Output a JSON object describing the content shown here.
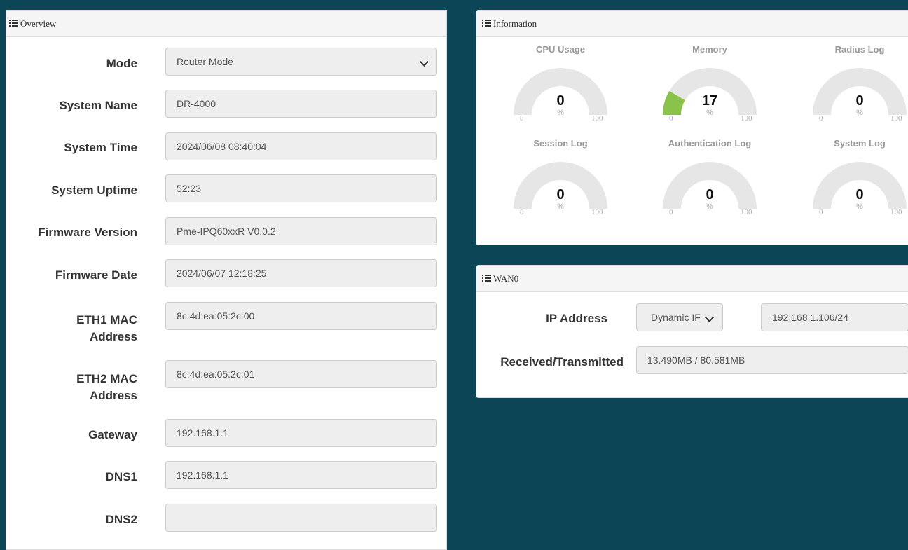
{
  "overview": {
    "title": "Overview",
    "fields": [
      {
        "label": "Mode",
        "value": "Router Mode"
      },
      {
        "label": "System Name",
        "value": "DR-4000"
      },
      {
        "label": "System Time",
        "value": "2024/06/08 08:40:04"
      },
      {
        "label": "System Uptime",
        "value": "52:23"
      },
      {
        "label": "Firmware Version",
        "value": "Pme-IPQ60xxR V0.0.2"
      },
      {
        "label": "Firmware Date",
        "value": "2024/06/07 12:18:25"
      },
      {
        "label_line1": "ETH1 MAC",
        "label_line2": "Address",
        "value": "8c:4d:ea:05:2c:00"
      },
      {
        "label_line1": "ETH2 MAC",
        "label_line2": "Address",
        "value": "8c:4d:ea:05:2c:01"
      },
      {
        "label": "Gateway",
        "value": "192.168.1.1"
      },
      {
        "label": "DNS1",
        "value": "192.168.1.1"
      },
      {
        "label": "DNS2",
        "value": ""
      }
    ]
  },
  "information": {
    "title": "Information",
    "gauge_color": "#8bc34a",
    "track_color": "#e6e6e6",
    "gauges": [
      {
        "title": "CPU Usage",
        "value": 0,
        "unit": "%",
        "min": "0",
        "max": "100"
      },
      {
        "title": "Memory",
        "value": 17,
        "unit": "%",
        "min": "0",
        "max": "100"
      },
      {
        "title": "Radius Log",
        "value": 0,
        "unit": "%",
        "min": "0",
        "max": "100"
      },
      {
        "title": "Session Log",
        "value": 0,
        "unit": "%",
        "min": "0",
        "max": "100"
      },
      {
        "title": "Authentication Log",
        "value": 0,
        "unit": "%",
        "min": "0",
        "max": "100"
      },
      {
        "title": "System Log",
        "value": 0,
        "unit": "%",
        "min": "0",
        "max": "100"
      }
    ]
  },
  "wan0": {
    "title": "WAN0",
    "ip_label": "IP Address",
    "ip_mode": "Dynamic IF",
    "ip_value": "192.168.1.106/24",
    "traffic_label": "Received/Transmitted",
    "traffic_value": "13.490MB / 80.581MB"
  },
  "colors": {
    "background": "#0b4556",
    "panel_header": "#f5f5f5",
    "field_bg": "#eeeeee"
  }
}
